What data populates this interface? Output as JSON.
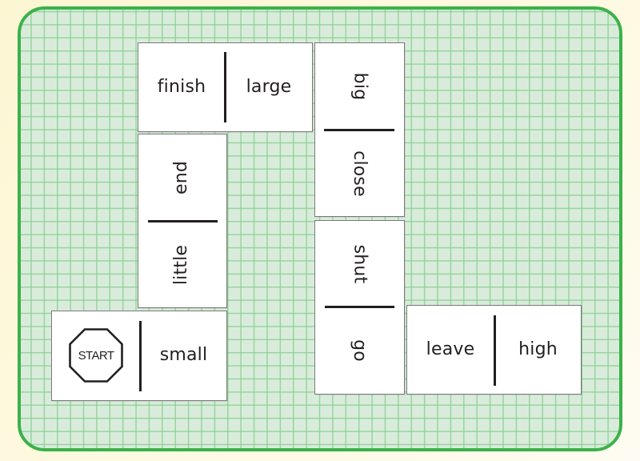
{
  "puzzle": {
    "type": "opposites-domino-path",
    "colors": {
      "board_border": "#3bb14a",
      "board_fill": "#d9ecdb",
      "grid_line": "#82cd8c",
      "tile_fill": "#ffffff",
      "tile_border": "#7a7a7a",
      "ink": "#231f20"
    },
    "dominoes": [
      {
        "id": "start-small",
        "orientation": "horizontal",
        "left": {
          "icon": "stop-sign-icon",
          "label": "START"
        },
        "right": {
          "label": "small"
        }
      },
      {
        "id": "end-little",
        "orientation": "vertical",
        "top": {
          "label": "end"
        },
        "bottom": {
          "label": "little"
        }
      },
      {
        "id": "finish-large",
        "orientation": "horizontal",
        "left": {
          "label": "finish"
        },
        "right": {
          "label": "large"
        }
      },
      {
        "id": "big-close",
        "orientation": "vertical",
        "top": {
          "label": "big"
        },
        "bottom": {
          "label": "close"
        }
      },
      {
        "id": "shut-go",
        "orientation": "vertical",
        "top": {
          "label": "shut"
        },
        "bottom": {
          "label": "go"
        }
      },
      {
        "id": "leave-high",
        "orientation": "horizontal",
        "left": {
          "label": "leave"
        },
        "right": {
          "label": "high"
        }
      }
    ]
  }
}
